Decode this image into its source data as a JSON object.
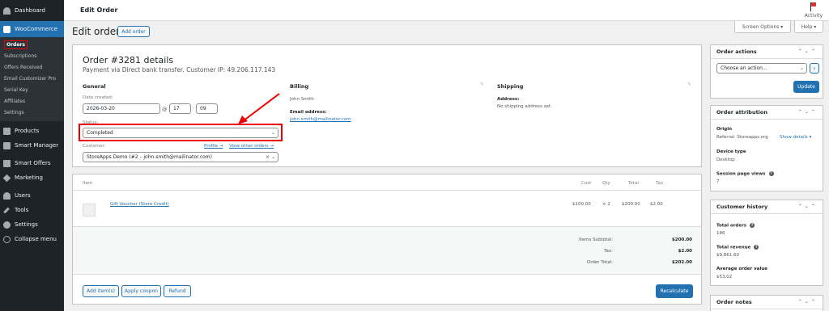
{
  "sidebar": {
    "items": [
      {
        "label": "Dashboard",
        "icon": "dashboard-icon"
      },
      {
        "label": "WooCommerce",
        "icon": "woocommerce-icon"
      }
    ],
    "woo_sub": [
      "Orders",
      "Subscriptions",
      "Offers Received",
      "Email Customizer Pro",
      "Serial Key",
      "Affiliates",
      "Settings"
    ],
    "bottom_items": [
      {
        "label": "Products",
        "icon": "products-icon"
      },
      {
        "label": "Smart Manager",
        "icon": "smart-manager-icon"
      },
      {
        "label": "Smart Offers",
        "icon": "smart-offers-icon"
      },
      {
        "label": "Marketing",
        "icon": "marketing-icon"
      },
      {
        "label": "Users",
        "icon": "users-icon"
      },
      {
        "label": "Tools",
        "icon": "tools-icon"
      },
      {
        "label": "Settings",
        "icon": "settings-icon"
      },
      {
        "label": "Collapse menu",
        "icon": "collapse-icon"
      }
    ]
  },
  "topbar": {
    "title": "Edit Order",
    "activity": "Activity"
  },
  "header": {
    "title": "Edit order",
    "add_order": "Add order",
    "screen_options": "Screen Options",
    "help": "Help"
  },
  "order": {
    "title": "Order #3281 details",
    "subtitle": "Payment via Direct bank transfer. Customer IP: 49.206.117.143",
    "general": {
      "heading": "General",
      "date_label": "Date created:",
      "date": "2026-03-20",
      "at": "@",
      "hour": "17",
      "minute": "09",
      "status_label": "Status:",
      "status": "Completed",
      "customer_label": "Customer:",
      "profile_link": "Profile →",
      "other_orders_link": "View other orders →",
      "customer": "StoreApps Demo (#2 – john.smith@mailinator.com)"
    },
    "billing": {
      "heading": "Billing",
      "name": "John Smith",
      "email_label": "Email address:",
      "email": "john.smith@mailinator.com"
    },
    "shipping": {
      "heading": "Shipping",
      "address_label": "Address:",
      "address": "No shipping address set."
    }
  },
  "items": {
    "headers": {
      "item": "Item",
      "cost": "Cost",
      "qty": "Qty",
      "total": "Total",
      "tax": "Tax"
    },
    "rows": [
      {
        "name": "Gift Voucher (Store Credit)",
        "cost": "$100.00",
        "qty": "× 2",
        "total": "$200.00",
        "tax": "$2.00"
      }
    ],
    "totals": [
      {
        "label": "Items Subtotal:",
        "value": "$200.00"
      },
      {
        "label": "Tax:",
        "value": "$2.00"
      },
      {
        "label": "Order Total:",
        "value": "$202.00"
      }
    ],
    "buttons": {
      "add_items": "Add item(s)",
      "apply_coupon": "Apply coupon",
      "refund": "Refund",
      "recalculate": "Recalculate"
    }
  },
  "actions": {
    "title": "Order actions",
    "select": "Choose an action...",
    "go": "›",
    "update": "Update"
  },
  "attribution": {
    "title": "Order attribution",
    "origin_label": "Origin",
    "origin": "Referral: Storeapps.org",
    "show_details": "Show details ▾",
    "device_label": "Device type",
    "device": "Desktop",
    "session_label": "Session page views",
    "session": "7"
  },
  "history": {
    "title": "Customer history",
    "total_orders_label": "Total orders",
    "total_orders": "186",
    "revenue_label": "Total revenue",
    "revenue": "$9,861.60",
    "avg_label": "Average order value",
    "avg": "$53.02"
  },
  "notes": {
    "title": "Order notes"
  },
  "colors": {
    "accent": "#2271b1",
    "highlight": "#e00000",
    "sidebar": "#1d2327"
  }
}
